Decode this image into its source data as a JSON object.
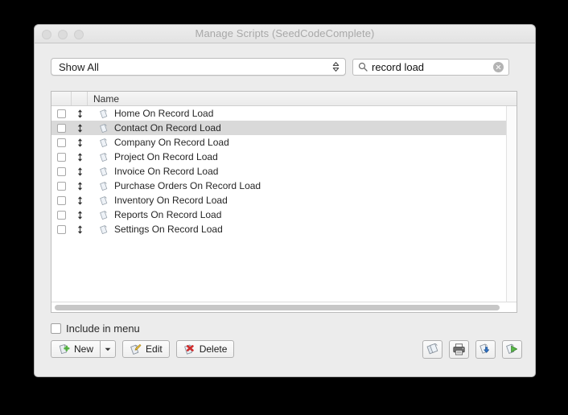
{
  "window": {
    "title": "Manage Scripts (SeedCodeComplete)",
    "traffic_lights": [
      "close-button",
      "minimize-button",
      "zoom-button"
    ]
  },
  "toolbar": {
    "filter_popup": {
      "label": "Show All",
      "icon": "updown-chevron-icon"
    },
    "search": {
      "value": "record load",
      "placeholder": "Search",
      "icon": "search-icon",
      "clear_icon": "clear-icon"
    }
  },
  "list": {
    "columns": {
      "checkbox": "",
      "move": "",
      "name": "Name"
    },
    "rows": [
      {
        "name": "Home On Record Load",
        "selected": false,
        "icon": "script-icon"
      },
      {
        "name": "Contact On Record Load",
        "selected": true,
        "icon": "script-icon"
      },
      {
        "name": "Company On Record Load",
        "selected": false,
        "icon": "script-icon"
      },
      {
        "name": "Project On Record Load",
        "selected": false,
        "icon": "script-icon"
      },
      {
        "name": "Invoice On Record Load",
        "selected": false,
        "icon": "script-icon"
      },
      {
        "name": "Purchase Orders On Record Load",
        "selected": false,
        "icon": "script-icon"
      },
      {
        "name": "Inventory On Record Load",
        "selected": false,
        "icon": "script-icon"
      },
      {
        "name": "Reports On Record Load",
        "selected": false,
        "icon": "script-icon"
      },
      {
        "name": "Settings On Record Load",
        "selected": false,
        "icon": "script-icon"
      }
    ]
  },
  "footer": {
    "include_in_menu": {
      "label": "Include in menu",
      "checked": false
    },
    "buttons": {
      "new": "New",
      "new_dropdown": "new-options-dropdown",
      "edit": "Edit",
      "delete": "Delete"
    },
    "icon_buttons": [
      {
        "name": "duplicate-script-button"
      },
      {
        "name": "print-button"
      },
      {
        "name": "import-script-button"
      },
      {
        "name": "run-script-button"
      }
    ]
  },
  "colors": {
    "window_bg": "#ececec",
    "list_bg": "#ffffff",
    "selection": "#d9d9d9",
    "title_text": "#a8a8a8",
    "accent_green": "#5ab947",
    "accent_red": "#cf2c2c",
    "accent_blue": "#2f72c4",
    "desktop": "#000000"
  }
}
